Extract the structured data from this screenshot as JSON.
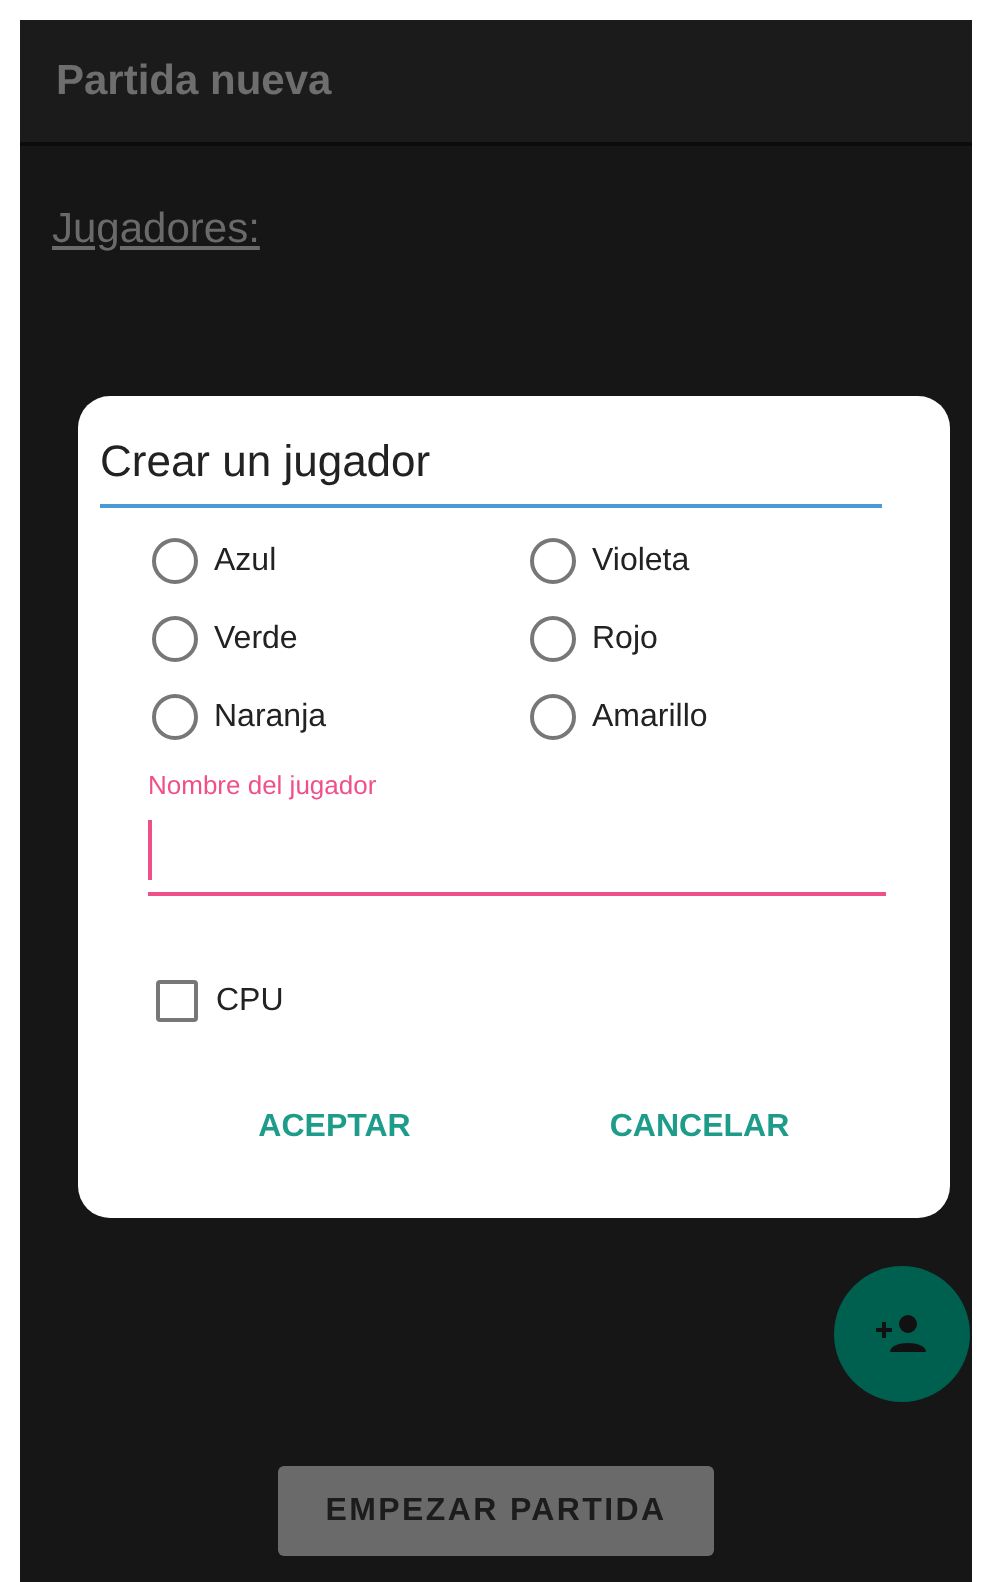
{
  "app_bar": {
    "title": "Partida nueva"
  },
  "players_heading": "Jugadores:",
  "dialog": {
    "title": "Crear un jugador",
    "colors": [
      {
        "label": "Azul",
        "selected": false
      },
      {
        "label": "Violeta",
        "selected": false
      },
      {
        "label": "Verde",
        "selected": false
      },
      {
        "label": "Rojo",
        "selected": false
      },
      {
        "label": "Naranja",
        "selected": false
      },
      {
        "label": "Amarillo",
        "selected": false
      }
    ],
    "name_field": {
      "label": "Nombre del jugador",
      "focused": true
    },
    "cpu": {
      "label": "CPU",
      "checked": false
    },
    "buttons": [
      "ACEPTAR",
      "CANCELAR"
    ]
  },
  "start_button": "EMPEZAR PARTIDA"
}
